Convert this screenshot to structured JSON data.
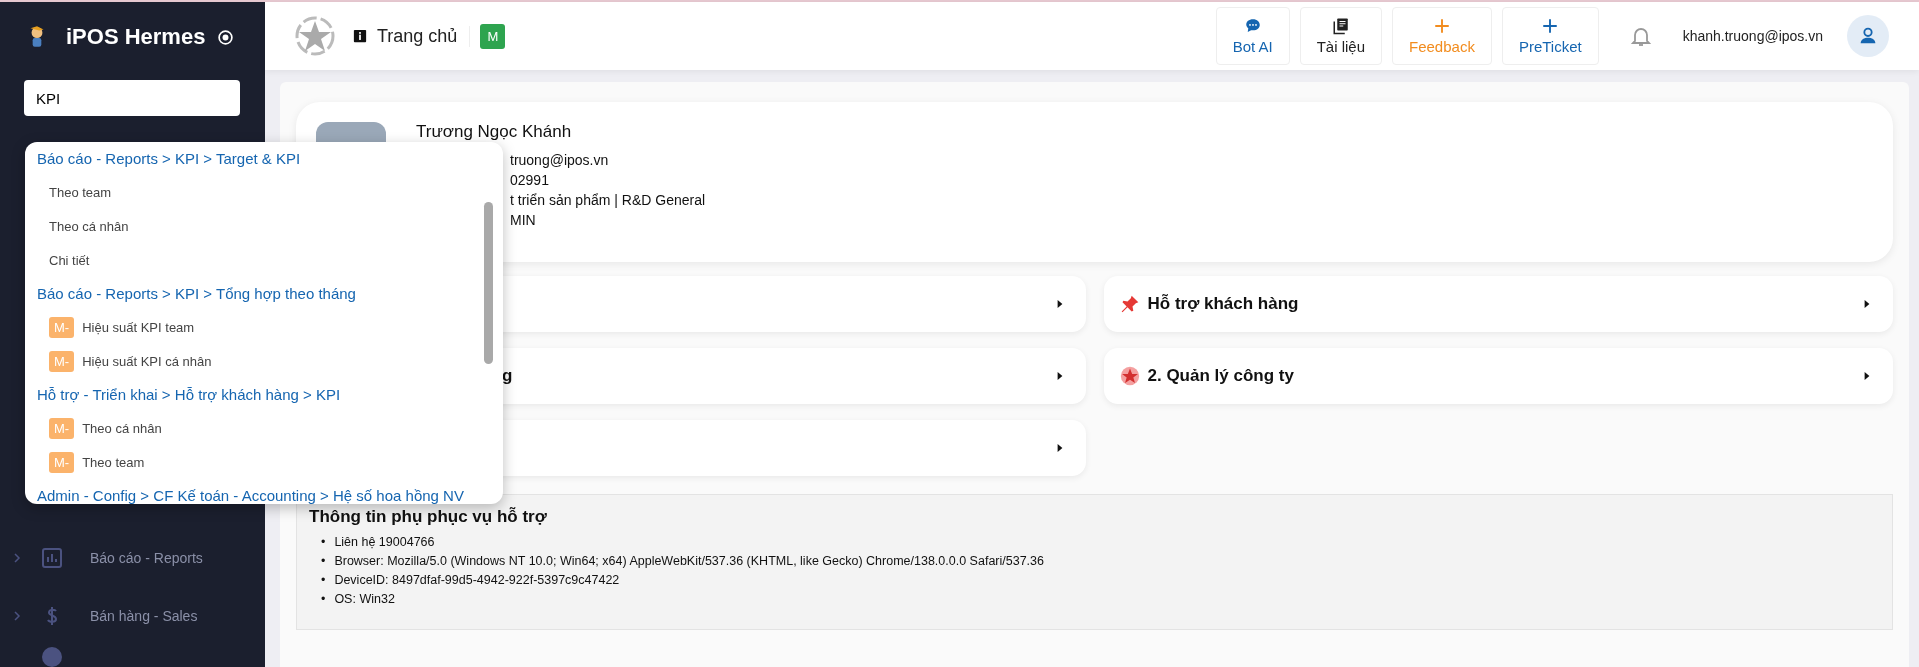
{
  "sidebar": {
    "title": "iPOS Hermes",
    "search": {
      "value": "KPI"
    },
    "items": [
      {
        "label": "Báo cáo - Reports",
        "kind": "chart"
      },
      {
        "label": "Bán hàng - Sales",
        "kind": "dollar"
      }
    ]
  },
  "search_results": [
    {
      "path": "Báo cáo - Reports > KPI > Target & KPI",
      "items": [
        {
          "label": "Theo team"
        },
        {
          "label": "Theo cá nhân"
        },
        {
          "label": "Chi tiết"
        }
      ]
    },
    {
      "path": "Báo cáo - Reports > KPI > Tổng hợp theo tháng",
      "items": [
        {
          "label": "Hiệu suất KPI team",
          "badge": "M-"
        },
        {
          "label": "Hiệu suất KPI cá nhân",
          "badge": "M-"
        }
      ]
    },
    {
      "path": "Hỗ trợ - Triển khai > Hỗ trợ khách hàng > KPI",
      "items": [
        {
          "label": "Theo cá nhân",
          "badge": "M-"
        },
        {
          "label": "Theo team",
          "badge": "M-"
        }
      ]
    },
    {
      "path": "Admin - Config > CF Kế toán - Accounting > Hệ số hoa hồng NV"
    }
  ],
  "topbar": {
    "page_title": "Trang chủ",
    "badge": "M",
    "buttons": [
      {
        "label": "Bot AI",
        "kind": "chat",
        "color": "#1565b0"
      },
      {
        "label": "Tài liệu",
        "kind": "book",
        "color": "#222222"
      },
      {
        "label": "Feedback",
        "kind": "plus",
        "color": "#f28c1e"
      },
      {
        "label": "PreTicket",
        "kind": "plus",
        "color": "#1565b0"
      }
    ],
    "user_email": "khanh.truong@ipos.vn"
  },
  "profile": {
    "name": "Trương Ngọc Khánh",
    "lines": [
      "truong@ipos.vn",
      "02991",
      "t triển sản phẩm | R&D General",
      "MIN"
    ]
  },
  "menu_cards": {
    "left": [
      {
        "kind": "blank"
      },
      {
        "kind": "text",
        "label": "g"
      },
      {
        "kind": "blank"
      }
    ],
    "right": [
      {
        "kind": "pin",
        "label": "Hỗ trợ khách hàng"
      },
      {
        "kind": "star",
        "label": "2. Quản lý công ty"
      }
    ]
  },
  "support_info": {
    "title": "Thông tin phụ phục vụ hỗ trợ",
    "marker": "•",
    "items": [
      "Liên hệ 19004766",
      "Browser: Mozilla/5.0 (Windows NT 10.0; Win64; x64) AppleWebKit/537.36 (KHTML, like Gecko) Chrome/138.0.0.0 Safari/537.36",
      "DeviceID: 8497dfaf-99d5-4942-922f-5397c9c47422",
      "OS: Win32"
    ]
  }
}
